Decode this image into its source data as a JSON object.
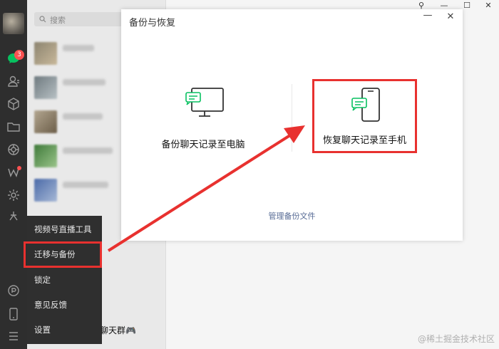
{
  "search": {
    "placeholder": "搜索"
  },
  "rail": {
    "unread_count": "3"
  },
  "dialog": {
    "title": "备份与恢复",
    "option_backup_pc": "备份聊天记录至电脑",
    "option_restore_phone": "恢复聊天记录至手机",
    "manage_link": "管理备份文件"
  },
  "menu": {
    "items": [
      "视频号直播工具",
      "迁移与备份",
      "锁定",
      "意见反馈",
      "设置"
    ]
  },
  "chatlist": {
    "partial_text": "聊天群🎮"
  },
  "watermark": "@稀土掘金技术社区",
  "colors": {
    "highlight": "#e8312f",
    "link": "#576b95",
    "wechat_green": "#07c160"
  }
}
